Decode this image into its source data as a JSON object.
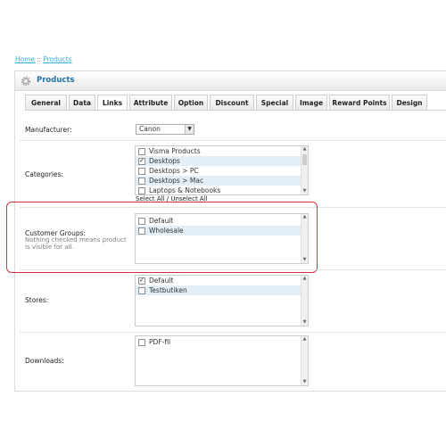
{
  "breadcrumb": {
    "home": "Home",
    "separator": "::",
    "current": "Products"
  },
  "heading": {
    "title": "Products",
    "icon": "gear-icon"
  },
  "tabs": [
    {
      "label": "General"
    },
    {
      "label": "Data"
    },
    {
      "label": "Links",
      "active": true
    },
    {
      "label": "Attribute"
    },
    {
      "label": "Option"
    },
    {
      "label": "Discount"
    },
    {
      "label": "Special"
    },
    {
      "label": "Image"
    },
    {
      "label": "Reward Points"
    },
    {
      "label": "Design"
    }
  ],
  "manufacturer": {
    "label": "Manufacturer:",
    "value": "Canon"
  },
  "categories": {
    "label": "Categories:",
    "items": [
      {
        "label": "Visma Products",
        "checked": false
      },
      {
        "label": "Desktops",
        "checked": true
      },
      {
        "label": "Desktops > PC",
        "checked": false
      },
      {
        "label": "Desktops > Mac",
        "checked": false
      },
      {
        "label": "Laptops & Notebooks",
        "checked": false
      }
    ],
    "select_all": "Select All",
    "divider": "/",
    "unselect_all": "Unselect All"
  },
  "customer_groups": {
    "label": "Customer Groups:",
    "help": "Nothing checked means product is visible for all.",
    "items": [
      {
        "label": "Default",
        "checked": false
      },
      {
        "label": "Wholesale",
        "checked": false
      }
    ]
  },
  "stores": {
    "label": "Stores:",
    "items": [
      {
        "label": "Default",
        "checked": true
      },
      {
        "label": "Testbutiken",
        "checked": false
      }
    ]
  },
  "downloads": {
    "label": "Downloads:",
    "items": [
      {
        "label": "PDF-fil",
        "checked": false
      }
    ]
  },
  "colors": {
    "accent": "#1f74a8",
    "highlight": "#d0333a",
    "row_alt": "#e4eef7"
  }
}
